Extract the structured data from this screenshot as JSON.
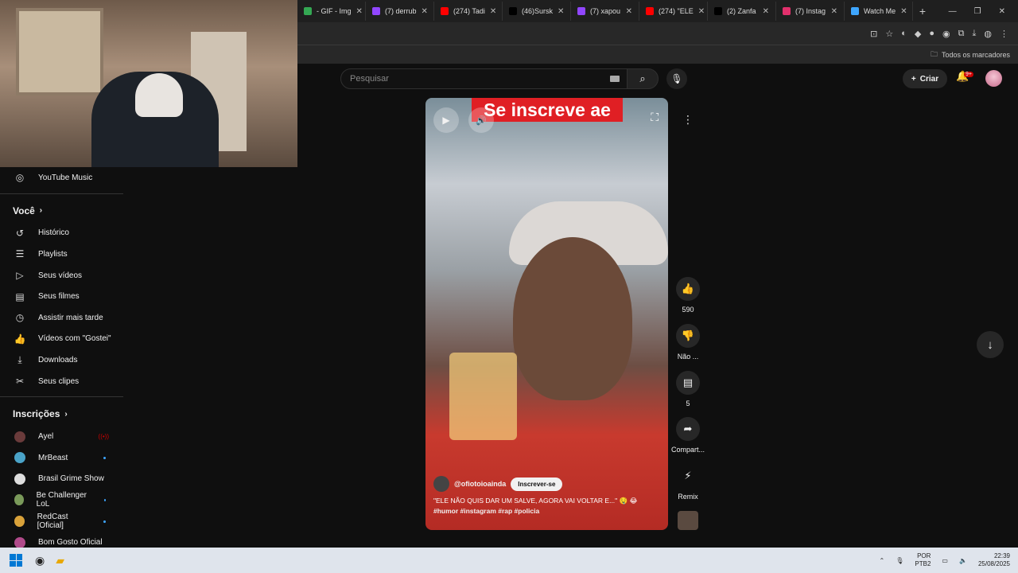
{
  "browser": {
    "tabs": [
      {
        "label": "- GIF - Img",
        "color": "#34a853"
      },
      {
        "label": "(7) derrub",
        "color": "#9146ff"
      },
      {
        "label": "(274) Tadi",
        "color": "#ff0000"
      },
      {
        "label": "(46)Sursk",
        "color": "#000000"
      },
      {
        "label": "(7) xapou",
        "color": "#9146ff"
      },
      {
        "label": "(274) \"ELE",
        "color": "#ff0000"
      },
      {
        "label": "(2) Zanfa",
        "color": "#000000"
      },
      {
        "label": "(7) Instag",
        "color": "#e1306c"
      },
      {
        "label": "Watch Me",
        "color": "#3ea6ff"
      }
    ],
    "bookmarks_label": "Todos os marcadores"
  },
  "sidebar": {
    "top_item": "YouTube Music",
    "voce_header": "Você",
    "voce_items": [
      {
        "label": "Histórico",
        "icon": "history-icon",
        "glyph": "↺"
      },
      {
        "label": "Playlists",
        "icon": "playlist-icon",
        "glyph": "☰"
      },
      {
        "label": "Seus vídeos",
        "icon": "video-icon",
        "glyph": "▷"
      },
      {
        "label": "Seus filmes",
        "icon": "film-icon",
        "glyph": "▤"
      },
      {
        "label": "Assistir mais tarde",
        "icon": "clock-icon",
        "glyph": "◷"
      },
      {
        "label": "Vídeos com \"Gostei\"",
        "icon": "thumb-up-icon",
        "glyph": "👍"
      },
      {
        "label": "Downloads",
        "icon": "download-icon",
        "glyph": "⤓"
      },
      {
        "label": "Seus clipes",
        "icon": "scissors-icon",
        "glyph": "✂"
      }
    ],
    "inscricoes_header": "Inscrições",
    "subscriptions": [
      {
        "label": "Ayel",
        "color": "#6a3b3b",
        "live": true
      },
      {
        "label": "MrBeast",
        "color": "#4aa3c8",
        "dot": true
      },
      {
        "label": "Brasil Grime Show",
        "color": "#dddddd"
      },
      {
        "label": "Be Challenger LoL",
        "color": "#7a9a5a",
        "dot": true
      },
      {
        "label": "RedCast [Oficial]",
        "color": "#d9a23a",
        "dot": true
      },
      {
        "label": "Bom Gosto Oficial",
        "color": "#b04a8a"
      }
    ]
  },
  "header": {
    "search_placeholder": "Pesquisar",
    "create_label": "Criar",
    "notif_badge": "9+"
  },
  "short": {
    "banner_text": "Se inscreve ae",
    "channel": "@ofiotoioainda",
    "subscribe_label": "Inscrever-se",
    "caption": "\"ELE NÃO QUIS DAR UM SALVE, AGORA VAI VOLTAR E...\" 🤤 😂",
    "hashtags": "#humor #instagram #rap #policia"
  },
  "actions": {
    "like_count": "590",
    "dislike_label": "Não ...",
    "comment_count": "5",
    "share_label": "Compart...",
    "remix_label": "Remix"
  },
  "taskbar": {
    "lang1": "POR",
    "lang2": "PTB2",
    "time": "22:39",
    "date": "25/08/2025"
  }
}
